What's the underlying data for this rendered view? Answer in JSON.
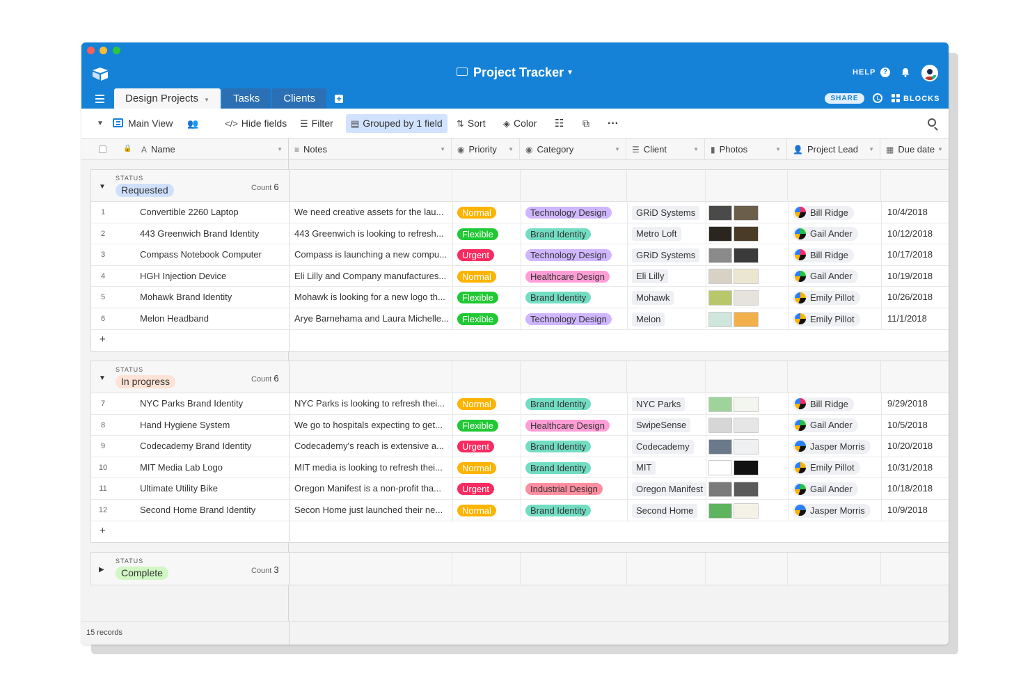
{
  "window": {
    "traffic_lights": [
      "close",
      "minimize",
      "zoom"
    ]
  },
  "header": {
    "title": "Project Tracker",
    "help_label": "HELP",
    "share_label": "SHARE",
    "blocks_label": "BLOCKS",
    "bg_color": "#1582d8"
  },
  "tabs": [
    {
      "label": "Design Projects",
      "active": true
    },
    {
      "label": "Tasks",
      "active": false
    },
    {
      "label": "Clients",
      "active": false
    }
  ],
  "toolbar": {
    "view_name": "Main View",
    "hide_fields": "Hide fields",
    "filter": "Filter",
    "grouped": "Grouped by 1 field",
    "sort": "Sort",
    "color": "Color"
  },
  "columns": {
    "name": "Name",
    "notes": "Notes",
    "priority": "Priority",
    "category": "Category",
    "client": "Client",
    "photos": "Photos",
    "lead": "Project Lead",
    "due": "Due date"
  },
  "status_label": "STATUS",
  "count_label": "Count",
  "colors": {
    "Normal": "#fcb400",
    "Flexible": "#20c933",
    "Urgent": "#f82b60",
    "Technology Design": "#cfb6ff",
    "Brand Identity": "#72ddc3",
    "Healthcare Design": "#ff9dd6",
    "Industrial Design": "#ff8ea0"
  },
  "groups": [
    {
      "status": "Requested",
      "count": "6",
      "color": "#cfe0fc",
      "expanded": true,
      "rows": [
        {
          "num": "1",
          "name": "Convertible 2260 Laptop",
          "notes": "We need creative assets for the lau...",
          "priority": "Normal",
          "category": "Technology Design",
          "client": "GRiD Systems",
          "lead": "Bill Ridge",
          "due": "10/4/2018",
          "photos": [
            "#4a4a48",
            "#6b5e4b"
          ]
        },
        {
          "num": "2",
          "name": "443 Greenwich Brand Identity",
          "notes": "443 Greenwich is looking to refresh...",
          "priority": "Flexible",
          "category": "Brand Identity",
          "client": "Metro Loft",
          "lead": "Gail Ander",
          "due": "10/12/2018",
          "photos": [
            "#2b2520",
            "#4a3a28"
          ]
        },
        {
          "num": "3",
          "name": "Compass Notebook Computer",
          "notes": "Compass is launching a new compu...",
          "priority": "Urgent",
          "category": "Technology Design",
          "client": "GRiD Systems",
          "lead": "Bill Ridge",
          "due": "10/17/2018",
          "photos": [
            "#8a8a8a",
            "#3a3a3a"
          ]
        },
        {
          "num": "4",
          "name": "HGH Injection Device",
          "notes": "Eli Lilly and Company manufactures...",
          "priority": "Normal",
          "category": "Healthcare Design",
          "client": "Eli Lilly",
          "lead": "Gail Ander",
          "due": "10/19/2018",
          "photos": [
            "#d8d2c4",
            "#ebe6d0"
          ]
        },
        {
          "num": "5",
          "name": "Mohawk Brand Identity",
          "notes": "Mohawk is looking for a new logo th...",
          "priority": "Flexible",
          "category": "Brand Identity",
          "client": "Mohawk",
          "lead": "Emily Pillot",
          "due": "10/26/2018",
          "photos": [
            "#b8c76a",
            "#e6e2dc"
          ]
        },
        {
          "num": "6",
          "name": "Melon Headband",
          "notes": "Arye Barnehama and Laura Michelle...",
          "priority": "Flexible",
          "category": "Technology Design",
          "client": "Melon",
          "lead": "Emily Pillot",
          "due": "11/1/2018",
          "photos": [
            "#cfe6dc",
            "#f2b04a"
          ]
        }
      ]
    },
    {
      "status": "In progress",
      "count": "6",
      "color": "#fee2d5",
      "expanded": true,
      "rows": [
        {
          "num": "7",
          "name": "NYC Parks Brand Identity",
          "notes": "NYC Parks is looking to refresh thei...",
          "priority": "Normal",
          "category": "Brand Identity",
          "client": "NYC Parks",
          "lead": "Bill Ridge",
          "due": "9/29/2018",
          "photos": [
            "#9ed49a",
            "#f3f6ef"
          ]
        },
        {
          "num": "8",
          "name": "Hand Hygiene System",
          "notes": "We go to hospitals expecting to get...",
          "priority": "Flexible",
          "category": "Healthcare Design",
          "client": "SwipeSense",
          "lead": "Gail Ander",
          "due": "10/5/2018",
          "photos": [
            "#d6d6d6",
            "#e6e6e6"
          ]
        },
        {
          "num": "9",
          "name": "Codecademy Brand Identity",
          "notes": "Codecademy's reach is extensive a...",
          "priority": "Urgent",
          "category": "Brand Identity",
          "client": "Codecademy",
          "lead": "Jasper Morris",
          "due": "10/20/2018",
          "photos": [
            "#6a7a8a",
            "#eef0f2"
          ]
        },
        {
          "num": "10",
          "name": "MIT Media Lab Logo",
          "notes": "MIT media is looking to refresh thei...",
          "priority": "Normal",
          "category": "Brand Identity",
          "client": "MIT",
          "lead": "Emily Pillot",
          "due": "10/31/2018",
          "photos": [
            "#ffffff",
            "#111111"
          ]
        },
        {
          "num": "11",
          "name": "Ultimate Utility Bike",
          "notes": "Oregon Manifest is a non-profit tha...",
          "priority": "Urgent",
          "category": "Industrial Design",
          "client": "Oregon Manifest",
          "lead": "Gail Ander",
          "due": "10/18/2018",
          "photos": [
            "#7a7a7a",
            "#5a5a5a"
          ]
        },
        {
          "num": "12",
          "name": "Second Home Brand Identity",
          "notes": "Secon Home just launched their ne...",
          "priority": "Normal",
          "category": "Brand Identity",
          "client": "Second Home",
          "lead": "Jasper Morris",
          "due": "10/9/2018",
          "photos": [
            "#5fb55f",
            "#f4f1e6"
          ]
        }
      ]
    },
    {
      "status": "Complete",
      "count": "3",
      "color": "#d1f7c4",
      "expanded": false,
      "rows": []
    }
  ],
  "leads": {
    "Bill Ridge": "#f82b60",
    "Gail Ander": "#20c933",
    "Emily Pillot": "#fcb400",
    "Jasper Morris": "#2d7ff9"
  },
  "footer": {
    "records": "15 records"
  }
}
